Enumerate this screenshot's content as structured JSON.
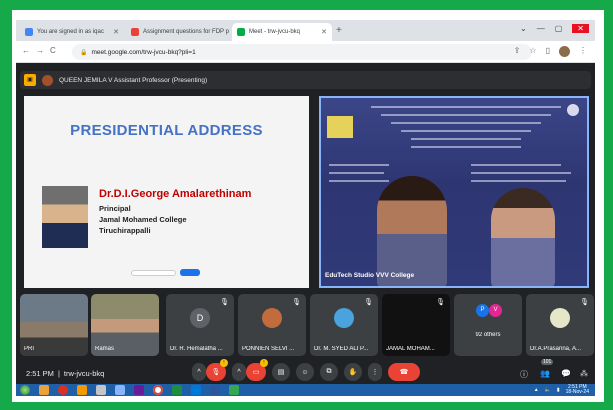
{
  "browser": {
    "tabs": [
      {
        "label": "You are signed in as iqac",
        "favicon_color": "#4285f4"
      },
      {
        "label": "Assignment questions for FDP p",
        "favicon_color": "#ea4335"
      },
      {
        "label": "Meet - trw-jvcu-bkq",
        "favicon_color": "#00ac47"
      }
    ],
    "new_tab_glyph": "+",
    "url": "meet.google.com/trw-jvcu-bkq?pli=1"
  },
  "meet": {
    "presenter_text": "QUEEN JEMILA V Assistant Professor (Presenting)",
    "slide": {
      "title": "PRESIDENTIAL ADDRESS",
      "speaker_name": "Dr.D.I.George Amalarethinam",
      "line1": "Principal",
      "line2": "Jamal Mohamed College",
      "line3": "Tiruchirappalli"
    },
    "camera_label": "EduTech Studio VVV College",
    "participants": [
      {
        "name": "PRI",
        "style": "vid1"
      },
      {
        "name": "Ramas",
        "style": "vid2"
      },
      {
        "name": "Dr. R. Hemalatha ...",
        "initial": "D",
        "color": "#5f6368"
      },
      {
        "name": "PONNIEN SELVI ...",
        "initial": "",
        "color": "#c26b3c"
      },
      {
        "name": "Dr. M. SYED ALI P...",
        "initial": "",
        "color": "#4aa3df"
      },
      {
        "name": "JAMAL MOHAM...",
        "style": "vid3"
      },
      {
        "name": "92 others",
        "others": [
          "P",
          "V"
        ]
      },
      {
        "name": "Dr.A.Prasanna, A...",
        "initial": "",
        "color": "#e6e6c8"
      }
    ],
    "time": "2:51 PM",
    "separator": "|",
    "meeting_code": "trw-jvcu-bkq",
    "participant_count": "101",
    "mic_badge": "!",
    "cam_badge": "!"
  },
  "taskbar": {
    "clock_time": "2:51 PM",
    "clock_date": "18-Nov-24"
  },
  "colors": {
    "green_border": "#16a94a",
    "meet_bg": "#202124",
    "end_call": "#ea4335",
    "title_blue": "#4472c4",
    "name_red": "#c00000"
  }
}
